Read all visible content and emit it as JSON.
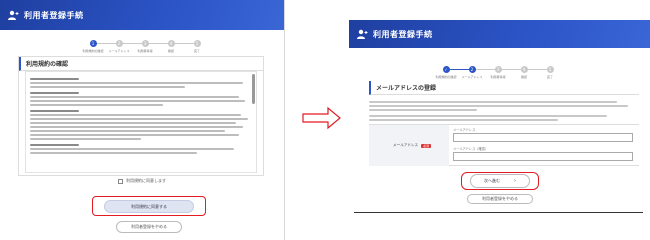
{
  "left": {
    "title": "利用者登録手続",
    "steps": [
      "利用規約の確認",
      "メールアドレス",
      "利用者情報",
      "確認",
      "完了"
    ],
    "active_step": 1,
    "section_title": "利用規約の確認",
    "agree_label": "利用規約に同意します",
    "next_button": "利用規約に同意する",
    "back_button": "利用者登録をやめる"
  },
  "right": {
    "title": "利用者登録手続",
    "steps": [
      "利用規約の確認",
      "メールアドレス",
      "利用者情報",
      "確認",
      "完了"
    ],
    "active_step": 2,
    "section_title": "メールアドレスの登録",
    "form_label": "メールアドレス",
    "required_badge": "必須",
    "field1_label": "メールアドレス",
    "field2_label": "メールアドレス（確認）",
    "next_button": "次へ進む",
    "next_chevron": "›",
    "back_button": "利用者登録をやめる"
  },
  "colors": {
    "brand": "#2c55c8",
    "highlight": "#e31b23"
  }
}
